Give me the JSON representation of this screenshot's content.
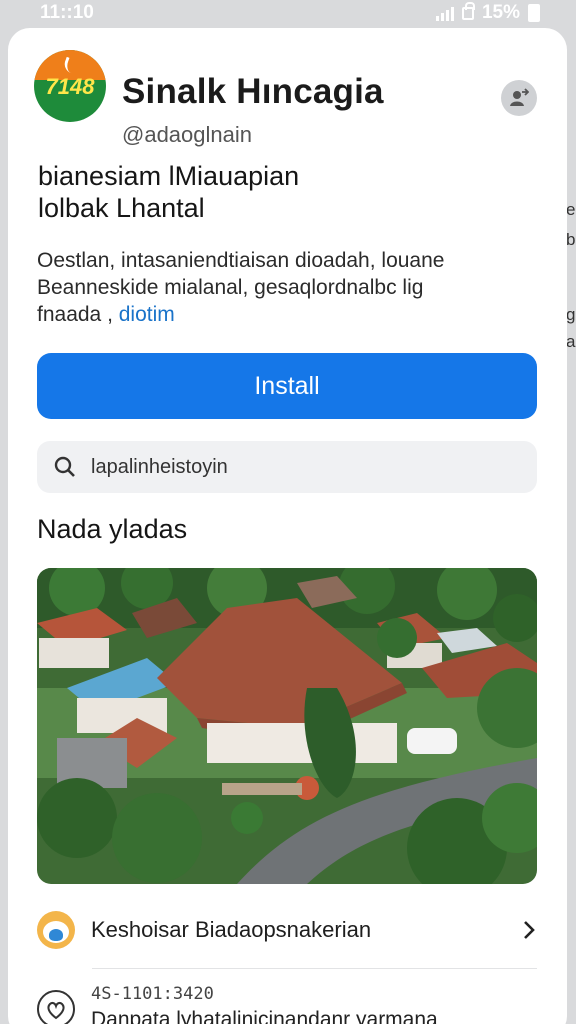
{
  "status_bar": {
    "time": "11::10",
    "battery": "15%"
  },
  "app": {
    "name": "Sinalk Hıncagia",
    "developer": "@adaoglnain",
    "logo_text": "7148",
    "subtitle_line1": "bianesiam lMiauapian",
    "subtitle_line2": "lolbak Lhantal",
    "description_line1": "Oestlan, intasaniendtiaisan dioadah, louane",
    "description_line2": "Beanneskide mialanal, gesaqlordnalbc lig",
    "description_line3_prefix": "fnaada ,",
    "description_link": "diotim"
  },
  "install_button": {
    "label": "Install"
  },
  "search": {
    "value": "lapalinheistoyin"
  },
  "section": {
    "title": "Nada yladas"
  },
  "photo": {
    "description": ""
  },
  "related": {
    "label": "Keshoisar Biadaopsnakerian"
  },
  "info": {
    "code": "4S-1101:3420",
    "text": "Danpata lyhatalinicinandanr yarmana"
  },
  "side_hints": [
    "e",
    "b",
    "g",
    "a"
  ],
  "colors": {
    "accent": "#1577e8",
    "link": "#1a73c9",
    "logo_orange": "#ef7f1a",
    "logo_green": "#1e8b3a"
  }
}
